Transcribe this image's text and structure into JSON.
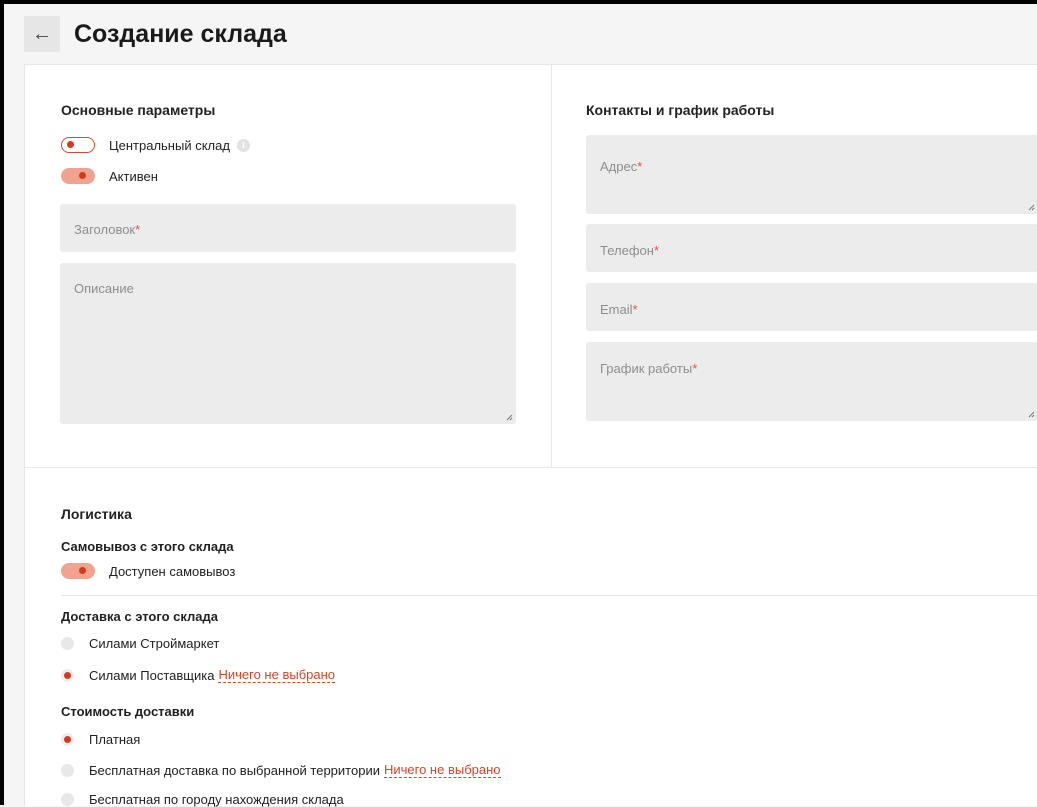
{
  "header": {
    "back_icon": "←",
    "title": "Создание склада"
  },
  "basic": {
    "title": "Основные параметры",
    "central_toggle": {
      "label": "Центральный склад",
      "state": "off",
      "info_icon": "i"
    },
    "active_toggle": {
      "label": "Активен",
      "state": "on"
    },
    "heading_field": {
      "placeholder": "Заголовок",
      "required_mark": "*"
    },
    "description_field": {
      "placeholder": "Описание"
    }
  },
  "contacts": {
    "title": "Контакты и график работы",
    "address": {
      "placeholder": "Адрес",
      "required_mark": "*"
    },
    "phone": {
      "placeholder": "Телефон",
      "required_mark": "*"
    },
    "email": {
      "placeholder": "Email",
      "required_mark": "*"
    },
    "schedule": {
      "placeholder": "График работы",
      "required_mark": "*"
    }
  },
  "logistics": {
    "title": "Логистика",
    "pickup": {
      "title": "Самовывоз с этого склада",
      "toggle_label": "Доступен самовывоз",
      "state": "on"
    },
    "delivery": {
      "title": "Доставка с этого склада",
      "options": [
        {
          "label": "Силами Строймаркет",
          "selected": false,
          "link": ""
        },
        {
          "label": "Силами Поставщика",
          "selected": true,
          "link": "Ничего не выбрано"
        }
      ]
    },
    "cost": {
      "title": "Стоимость доставки",
      "options": [
        {
          "label": "Платная",
          "selected": true,
          "link": ""
        },
        {
          "label": "Бесплатная доставка по выбранной территории",
          "selected": false,
          "link": "Ничего не выбрано"
        },
        {
          "label": "Бесплатная по городу нахождения склада",
          "selected": false,
          "link": ""
        }
      ]
    }
  },
  "colors": {
    "accent": "#d13a1a",
    "accent_light": "#f0a38f",
    "field_bg": "#ececec"
  }
}
